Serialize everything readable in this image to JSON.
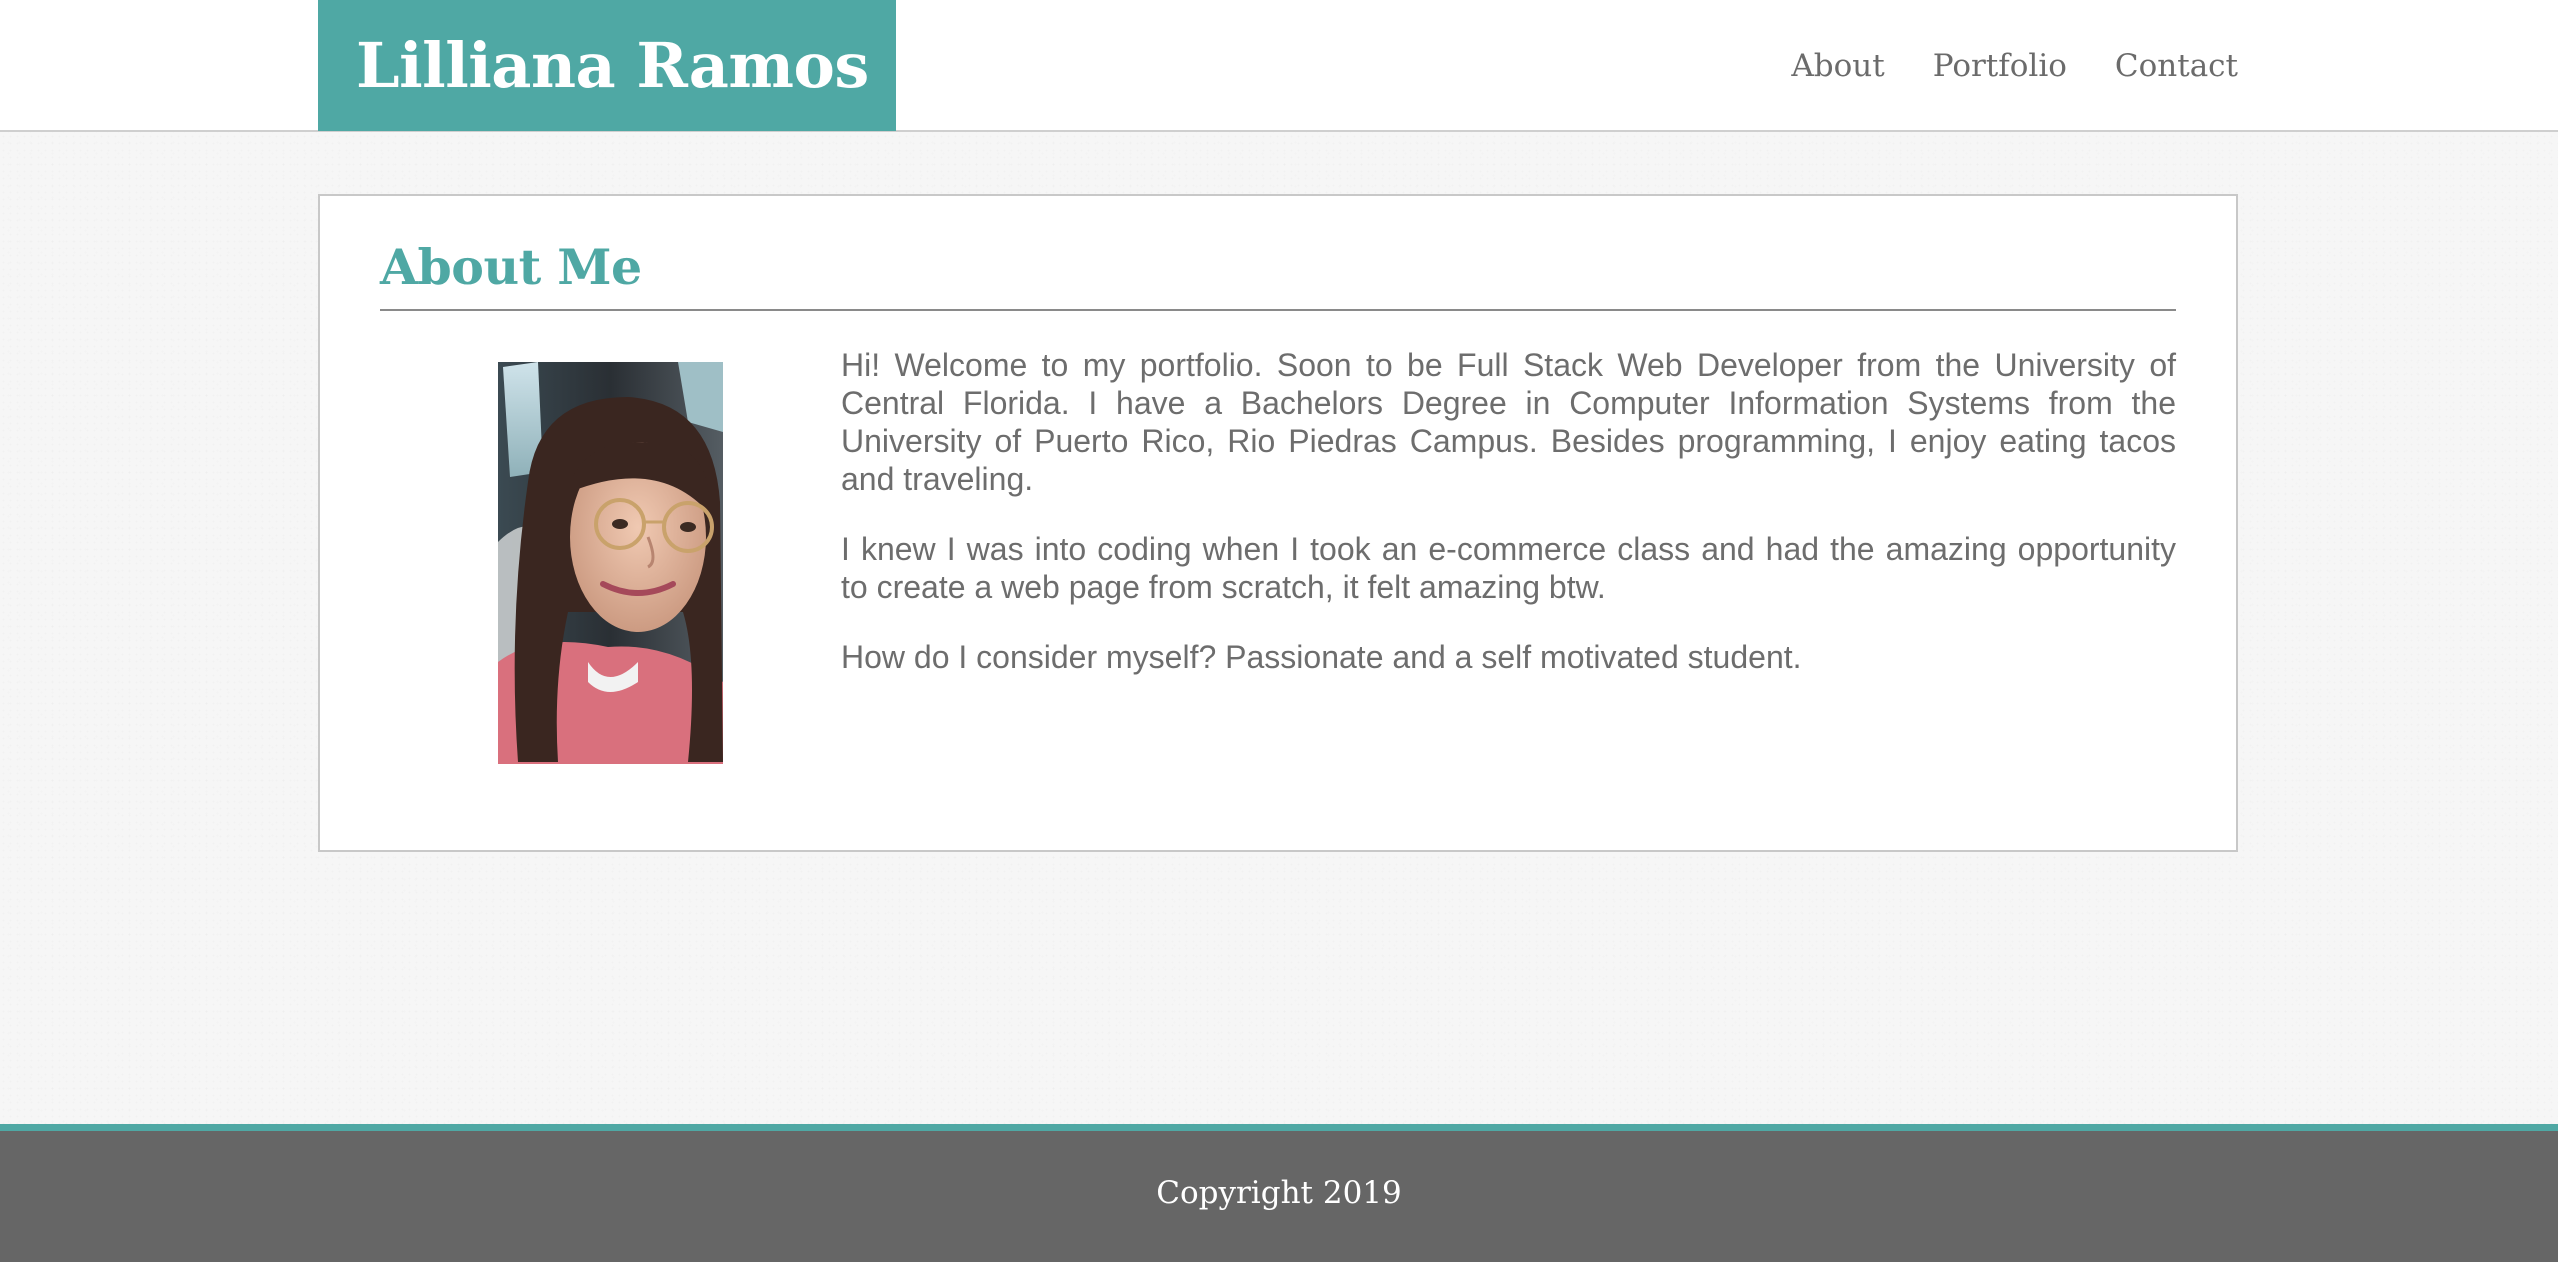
{
  "header": {
    "brand": "Lilliana Ramos",
    "nav": [
      {
        "label": "About"
      },
      {
        "label": "Portfolio"
      },
      {
        "label": "Contact"
      }
    ]
  },
  "about": {
    "title": "About Me",
    "photo_alt": "profile photo",
    "paragraphs": [
      "Hi! Welcome to my portfolio. Soon to be Full Stack Web Developer from the University of Central Florida. I have a Bachelors Degree in Computer Information Systems from the University of Puerto Rico, Rio Piedras Campus. Besides programming, I enjoy eating tacos and traveling.",
      "I knew I was into coding when I took an e-commerce class and had the amazing opportunity to create a web page from scratch, it felt amazing btw.",
      "How do I consider myself? Passionate and a self motivated student."
    ]
  },
  "footer": {
    "copyright": "Copyright 2019"
  },
  "colors": {
    "accent": "#4fa8a4",
    "footer_bg": "#666666",
    "text_gray": "#6d6d6d",
    "page_bg": "#f6f6f6"
  }
}
